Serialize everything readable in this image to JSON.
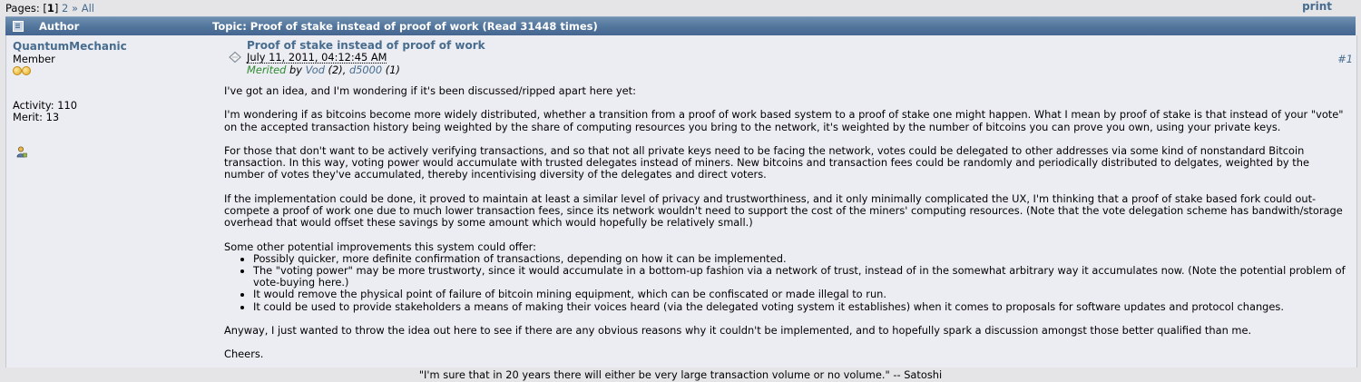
{
  "pagination": {
    "label": "Pages:",
    "open": "[",
    "current": "1",
    "close": "]",
    "page2": "2",
    "arrow": "»",
    "all": "All"
  },
  "print_label": "print",
  "header": {
    "author_label": "Author",
    "topic_label": "Topic: Proof of stake instead of proof of work  (Read 31448 times)"
  },
  "poster": {
    "name": "QuantumMechanic",
    "rank": "Member",
    "activity": "Activity: 110",
    "merit": "Merit: 13"
  },
  "post": {
    "subject": "Proof of stake instead of proof of work",
    "date": "July 11, 2011, 04:12:45 AM",
    "merited_label": "Merited",
    "by": " by ",
    "merit_user1": "Vod",
    "merit_count1": " (2), ",
    "merit_user2": "d5000",
    "merit_count2": " (1)",
    "number": "#1",
    "paragraphs": [
      "I've got an idea, and I'm wondering if it's been discussed/ripped apart here yet:",
      "I'm wondering if as bitcoins become more widely distributed, whether a transition from a proof of work based system to a proof of stake one might happen.  What I mean by proof of stake is that instead of your \"vote\" on the accepted transaction history being weighted by the share of computing resources you bring to the network, it's weighted by the number of bitcoins you can prove you own, using your private keys.",
      "For those that don't want to be actively verifying transactions, and so that not all private keys need to be facing the network, votes could be delegated to other addresses via some kind of nonstandard Bitcoin transaction.  In this way, voting power would accumulate with trusted delegates instead of miners.  New bitcoins and transaction fees could be randomly and periodically distributed to delgates, weighted by the number of votes they've accumulated, thereby incentivising diversity of the delegates and direct voters.",
      "If the implementation could be done, it proved to maintain at least a similar level of privacy and trustworthiness, and it only minimally complicated the UX, I'm thinking that a proof of stake based fork could out-compete a proof of work one due to much lower transaction fees, since its network wouldn't need to support the cost of the miners' computing resources.  (Note that the vote delegation scheme has bandwith/storage overhead that would offset these savings by some amount which would hopefully be relatively small.)",
      "Some other potential improvements this system could offer:"
    ],
    "bullets": [
      "Possibly quicker, more definite confirmation of transactions, depending on how it can be implemented.",
      "The \"voting power\" may be more trustworty, since it would accumulate in a bottom-up fashion via a network of trust, instead of in the somewhat arbitrary way it accumulates now.  (Note the potential problem of vote-buying here.)",
      "It would remove the physical point of failure of bitcoin mining equipment, which can be confiscated or made illegal to run.",
      "It could be used to provide stakeholders a means of making their voices heard (via the delegated voting system it establishes) when it comes to proposals for software updates and protocol changes."
    ],
    "closing": "Anyway, I just wanted to throw the idea out here to see if there are any obvious reasons why it couldn't be implemented, and to hopefully spark a discussion amongst those better qualified than me.",
    "signoff": "Cheers."
  },
  "footer_quote": "\"I'm sure that in 20 years there will either be very large transaction volume or no volume.\" -- Satoshi"
}
